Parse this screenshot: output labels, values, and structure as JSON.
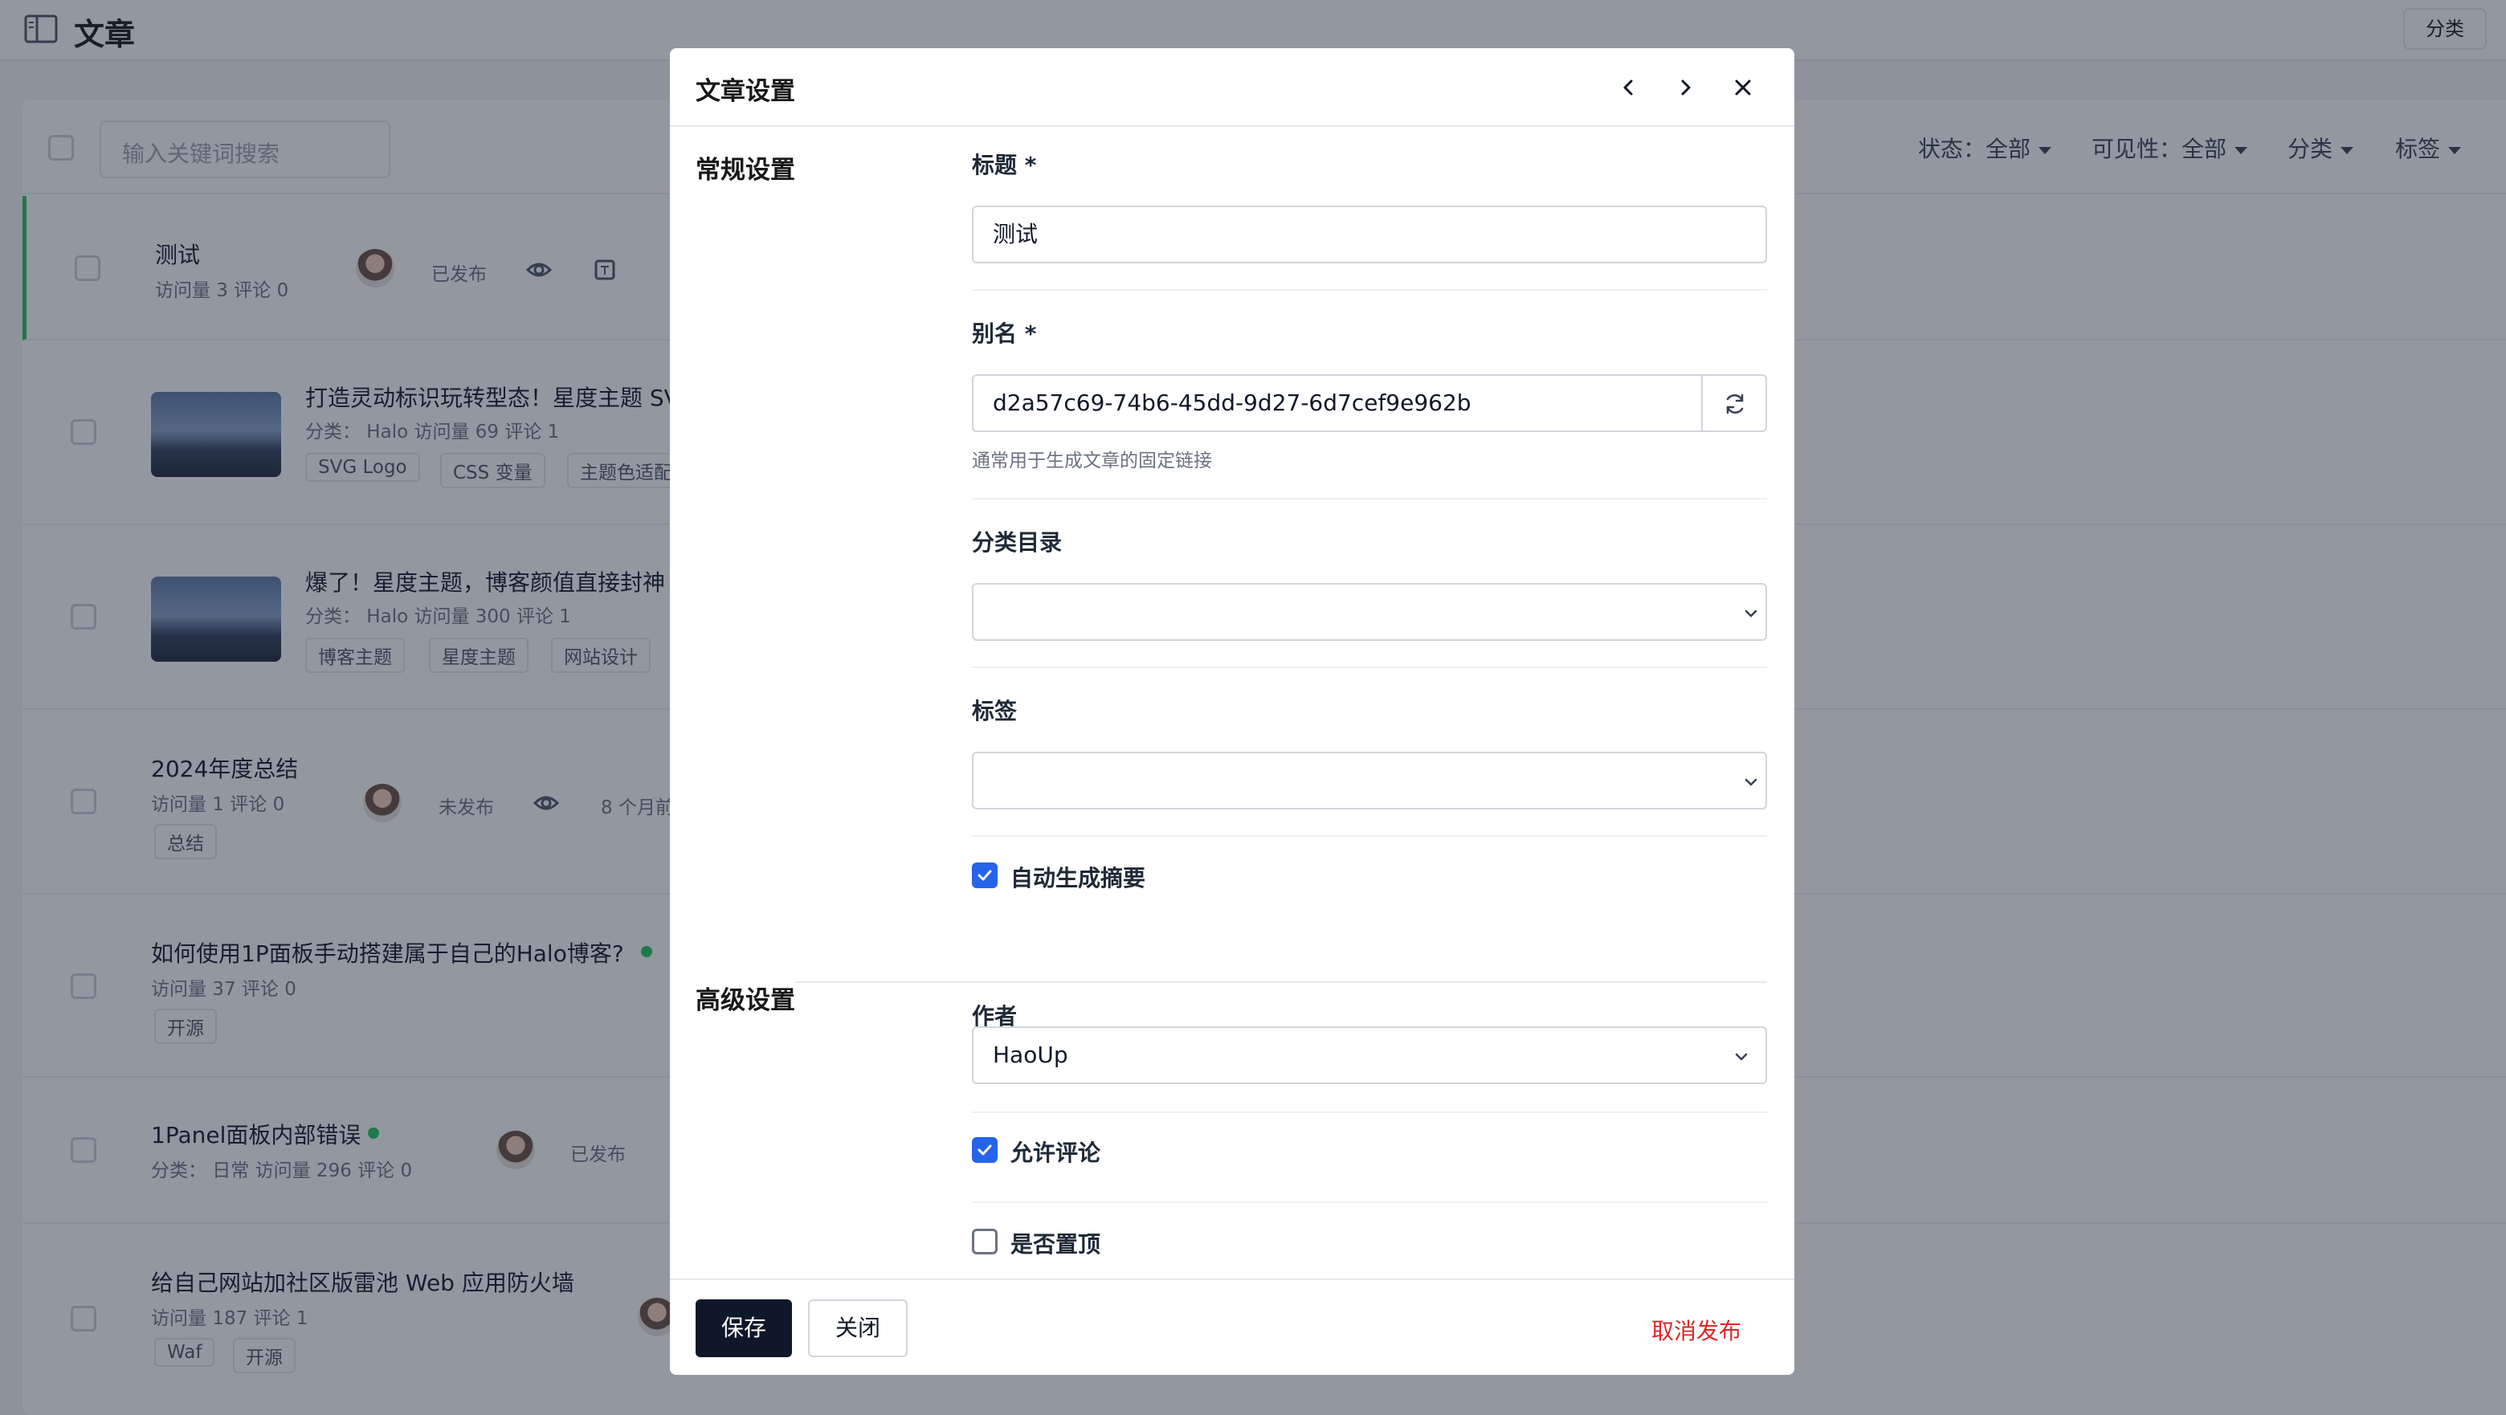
{
  "page": {
    "title": "文章",
    "category_button": "分类"
  },
  "filters": {
    "search_placeholder": "输入关键词搜索",
    "status": "状态：全部",
    "visibility": "可见性：全部",
    "category": "分类",
    "tag": "标签"
  },
  "posts": [
    {
      "title": "测试",
      "meta": "访问量 3   评论 0",
      "status": "已发布"
    },
    {
      "title": "打造灵动标识玩转型态！星度主题 SV",
      "meta": "分类：  Halo   访问量 69   评论 1",
      "tags": [
        "SVG Logo",
        "CSS 变量",
        "主题色适配"
      ]
    },
    {
      "title": "爆了！星度主题，博客颜值直接封神",
      "meta": "分类：  Halo   访问量 300   评论 1",
      "tags": [
        "博客主题",
        "星度主题",
        "网站设计"
      ]
    },
    {
      "title": "2024年度总结",
      "meta": "访问量 1   评论 0",
      "status": "未发布",
      "time": "8 个月前",
      "tags": [
        "总结"
      ]
    },
    {
      "title": "如何使用1P面板手动搭建属于自己的Halo博客?",
      "meta": "访问量 37   评论 0",
      "tags": [
        "开源"
      ]
    },
    {
      "title": "1Panel面板内部错误",
      "meta": "分类：  日常   访问量 296   评论 0",
      "status": "已发布"
    },
    {
      "title": "给自己网站加社区版雷池 Web 应用防火墙",
      "meta": "访问量 187   评论 1",
      "tags": [
        "Waf",
        "开源"
      ]
    }
  ],
  "modal": {
    "title": "文章设置",
    "general_section": "常规设置",
    "advanced_section": "高级设置",
    "title_label": "标题 *",
    "title_value": "测试",
    "slug_label": "别名 *",
    "slug_value": "d2a57c69-74b6-45dd-9d27-6d7cef9e962b",
    "slug_hint": "通常用于生成文章的固定链接",
    "category_label": "分类目录",
    "tags_label": "标签",
    "auto_excerpt_label": "自动生成摘要",
    "author_label": "作者",
    "author_value": "HaoUp",
    "allow_comment_label": "允许评论",
    "pinned_label": "是否置顶",
    "save": "保存",
    "close": "关闭",
    "unpublish": "取消发布"
  },
  "colors": {
    "primary": "#0f172a",
    "checkbox": "#2563eb",
    "danger": "#dc2626",
    "published_dot": "#22c55e"
  }
}
